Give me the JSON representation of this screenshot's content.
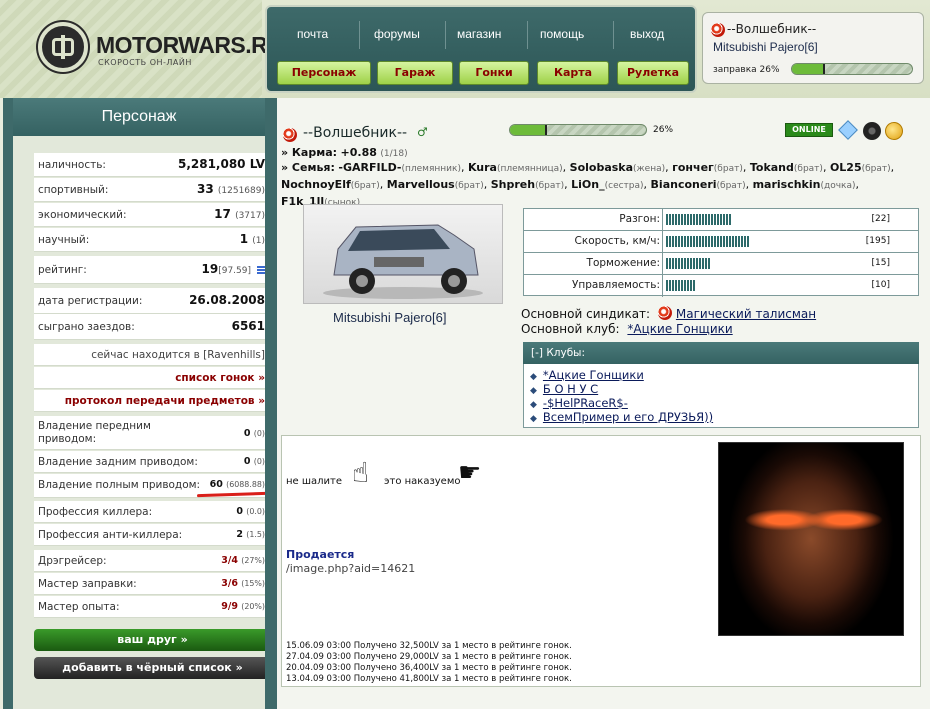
{
  "header": {
    "logo_text": "MOTORWARS.RU",
    "logo_sub": "СКОРОСТЬ ОН-ЛАЙН",
    "nav_links": [
      "почта",
      "форумы",
      "магазин",
      "помощь",
      "выход"
    ],
    "nav_buttons": [
      "Персонаж",
      "Гараж",
      "Гонки",
      "Карта",
      "Рулетка"
    ],
    "user": {
      "name": "--Волшебник--",
      "car": "Mitsubishi Pajero[6]",
      "fuel_label": "заправка 26%",
      "fuel": 0.26
    }
  },
  "left": {
    "title": "Персонаж",
    "stats": [
      {
        "label": "наличность:",
        "value": "5,281,080 LV",
        "sub": ""
      },
      {
        "label": "спортивный:",
        "value": "33",
        "sub": "(1251689)"
      },
      {
        "label": "экономический:",
        "value": "17",
        "sub": "(3717)"
      },
      {
        "label": "научный:",
        "value": "1",
        "sub": "(1)"
      }
    ],
    "rating": {
      "label": "рейтинг:",
      "value": "19",
      "sub": "[97.59]"
    },
    "reg": {
      "label": "дата регистрации:",
      "value": "26.08.2008"
    },
    "races": {
      "label": "сыграно заездов:",
      "value": "6561"
    },
    "location": "сейчас находится в [Ravenhills]",
    "links": [
      "список гонок »",
      "протокол передачи предметов »"
    ],
    "drive": [
      {
        "label": "Владение передним приводом:",
        "value": "0",
        "sub": "(0)"
      },
      {
        "label": "Владение задним приводом:",
        "value": "0",
        "sub": "(0)"
      },
      {
        "label": "Владение полным приводом:",
        "value": "60",
        "sub": "(6088.88)"
      }
    ],
    "profs": [
      {
        "label": "Профессия киллера:",
        "value": "0",
        "sub": "(0.0)"
      },
      {
        "label": "Профессия анти-киллера:",
        "value": "2",
        "sub": "(1.5)"
      }
    ],
    "masters": [
      {
        "label": "Дрэгрейсер:",
        "value": "3/4",
        "sub": "(27%)"
      },
      {
        "label": "Мастер заправки:",
        "value": "3/6",
        "sub": "(15%)"
      },
      {
        "label": "Мастер опыта:",
        "value": "9/9",
        "sub": "(20%)"
      }
    ],
    "btn_friend": "ваш друг »",
    "btn_black": "добавить в чёрный список »"
  },
  "main": {
    "name": "--Волшебник--",
    "gender": "♂",
    "fuel_pct": "26%",
    "fuel": 0.26,
    "online": "ONLINE",
    "karma_label": "» Карма:",
    "karma_value": "+0.88",
    "karma_sub": "(1/18)",
    "family_label": "» Семья:",
    "family": [
      {
        "n": "-GARFILD-",
        "r": "(племянник)"
      },
      {
        "n": "Kura",
        "r": "(племянница)"
      },
      {
        "n": "Solobaska",
        "r": "(жена)"
      },
      {
        "n": "гончег",
        "r": "(брат)"
      },
      {
        "n": "Tokand",
        "r": "(брат)"
      },
      {
        "n": "OL25",
        "r": "(брат)"
      },
      {
        "n": "NochnoyElf",
        "r": "(брат)"
      },
      {
        "n": "Marvellous",
        "r": "(брат)"
      },
      {
        "n": "Shpreh",
        "r": "(брат)"
      },
      {
        "n": "LiOn_",
        "r": "(сестра)"
      },
      {
        "n": "Bianconeri",
        "r": "(брат)"
      },
      {
        "n": "marischkin",
        "r": "(дочка)"
      },
      {
        "n": "F1k_1ll",
        "r": "(сынок)"
      }
    ],
    "car_caption": "Mitsubishi Pajero[6]",
    "car_stats": [
      {
        "label": "Разгон:",
        "value": "[22]",
        "level": 22
      },
      {
        "label": "Скорость, км/ч:",
        "value": "[195]",
        "level": 28
      },
      {
        "label": "Торможение:",
        "value": "[15]",
        "level": 15
      },
      {
        "label": "Управляемость:",
        "value": "[10]",
        "level": 10
      }
    ],
    "syndicate_label": "Основной синдикат:",
    "syndicate": "Магический талисман",
    "club_label": "Основной клуб:",
    "club": "*Ацкие Гонщики",
    "clubs_head": "[-]  Клубы:",
    "clubs": [
      "*Ацкие Гонщики",
      "Б О Н У С",
      "-$HelPRaceR$-",
      "ВсемПример и его ДРУЗЬЯ))"
    ],
    "info": {
      "text1": "не шалите",
      "text2": "это наказуемо",
      "sale_title": "Продается",
      "sale_link": "/image.php?aid=14621",
      "history": [
        "15.06.09 03:00 Получено 32,500LV за 1 место в рейтинге гонок.",
        "27.04.09 03:00 Получено 29,000LV за 1 место в рейтинге гонок.",
        "20.04.09 03:00 Получено 36,400LV за 1 место в рейтинге гонок.",
        "13.04.09 03:00 Получено 41,800LV за 1 место в рейтинге гонок."
      ]
    }
  }
}
